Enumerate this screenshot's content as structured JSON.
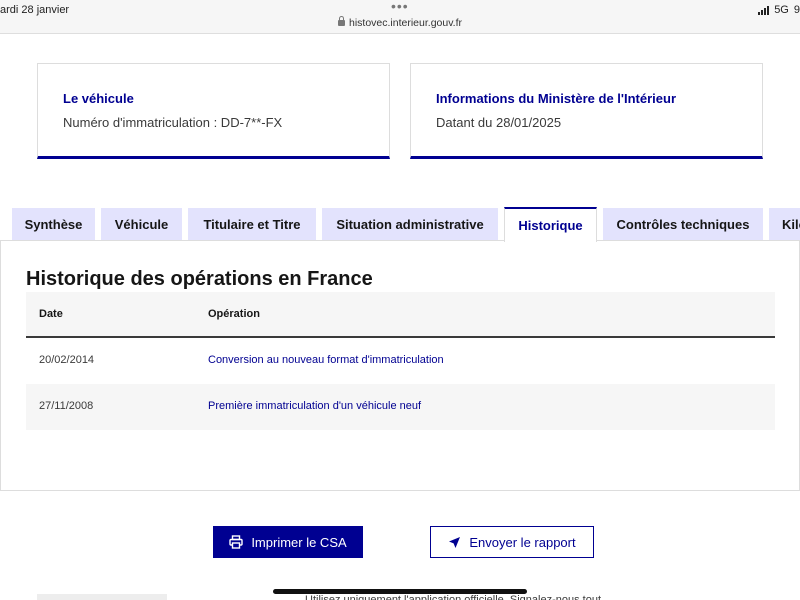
{
  "status_bar": {
    "time": "ardi 28 janvier",
    "url": "histovec.interieur.gouv.fr",
    "network": "5G",
    "battery": "9"
  },
  "cards": {
    "vehicle": {
      "title": "Le véhicule",
      "text": "Numéro d'immatriculation : DD-7**-FX"
    },
    "ministry": {
      "title": "Informations du Ministère de l'Intérieur",
      "text": "Datant du 28/01/2025"
    }
  },
  "tabs": [
    {
      "label": "Synthèse"
    },
    {
      "label": "Véhicule"
    },
    {
      "label": "Titulaire et Titre"
    },
    {
      "label": "Situation administrative"
    },
    {
      "label": "Historique",
      "active": true
    },
    {
      "label": "Contrôles techniques"
    },
    {
      "label": "Kilo"
    }
  ],
  "history": {
    "title": "Historique des opérations en France",
    "columns": [
      "Date",
      "Opération"
    ],
    "rows": [
      {
        "date": "20/02/2014",
        "operation": "Conversion au nouveau format d'immatriculation"
      },
      {
        "date": "27/11/2008",
        "operation": "Première immatriculation d'un véhicule neuf"
      }
    ]
  },
  "actions": {
    "print_label": "Imprimer le CSA",
    "send_label": "Envoyer le rapport"
  },
  "footer": {
    "partial_text": "Utilisez uniquement l'application officielle. Signalez-nous tout"
  },
  "colors": {
    "brand": "#000091",
    "tab_bg": "#e3e3fd",
    "row_alt": "#f6f6f6"
  }
}
